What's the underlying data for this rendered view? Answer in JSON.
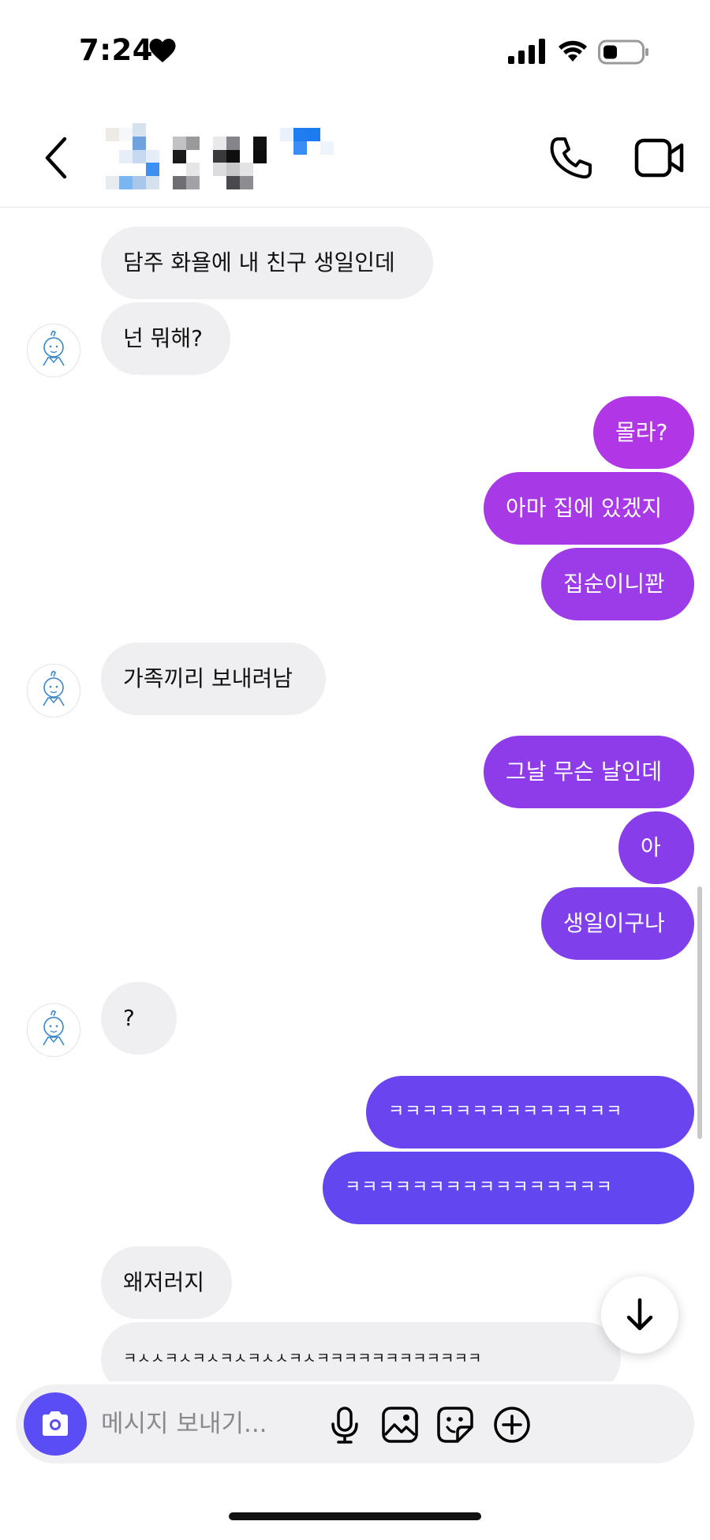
{
  "status_bar": {
    "time": "7:24"
  },
  "header": {
    "contact_name": ""
  },
  "messages": [
    {
      "side": "in",
      "text": "담주 화욜에 내 친구 생일인데"
    },
    {
      "side": "in",
      "text": "넌 뭐해?"
    },
    {
      "side": "out",
      "text": "몰라?",
      "color": "#b036e6"
    },
    {
      "side": "out",
      "text": "아마 집에 있겠지",
      "color": "#a73ae6"
    },
    {
      "side": "out",
      "text": "집순이니꽌",
      "color": "#9c3be8"
    },
    {
      "side": "in",
      "text": "가족끼리 보내려남"
    },
    {
      "side": "out",
      "text": "그날 무슨 날인데",
      "color": "#8e3ce9"
    },
    {
      "side": "out",
      "text": "아",
      "color": "#873eea"
    },
    {
      "side": "out",
      "text": "생일이구나",
      "color": "#7f40eb"
    },
    {
      "side": "in",
      "text": "?"
    },
    {
      "side": "out",
      "text": "ㅋㅋㅋㅋㅋㅋㅋㅋㅋㅋㅋㅋㅋㅋ",
      "color": "#6a44ef"
    },
    {
      "side": "out",
      "text": "ㅋㅋㅋㅋㅋㅋㅋㅋㅋㅋㅋㅋㅋㅋㅋㅋ",
      "color": "#6246f0"
    },
    {
      "side": "in",
      "text": "왜저러지"
    },
    {
      "side": "in",
      "text": "ㅋㅅㅅㅋㅅㅋㅅㅋㅅㅋㅅㅅㅋㅅㅋㅋㅋㅋㅋㅋㅋㅋㅋㅋㅋㅋ"
    }
  ],
  "composer": {
    "placeholder": "메시지 보내기..."
  },
  "icons": {
    "back": "chevron-left-icon",
    "call": "phone-icon",
    "video": "video-camera-icon",
    "camera": "camera-icon",
    "mic": "microphone-icon",
    "gallery": "image-icon",
    "sticker": "sticker-icon",
    "more": "plus-circle-icon",
    "jump": "arrow-down-icon"
  },
  "colors": {
    "accent": "#5b4df5",
    "incoming_bubble": "#efeff1"
  }
}
